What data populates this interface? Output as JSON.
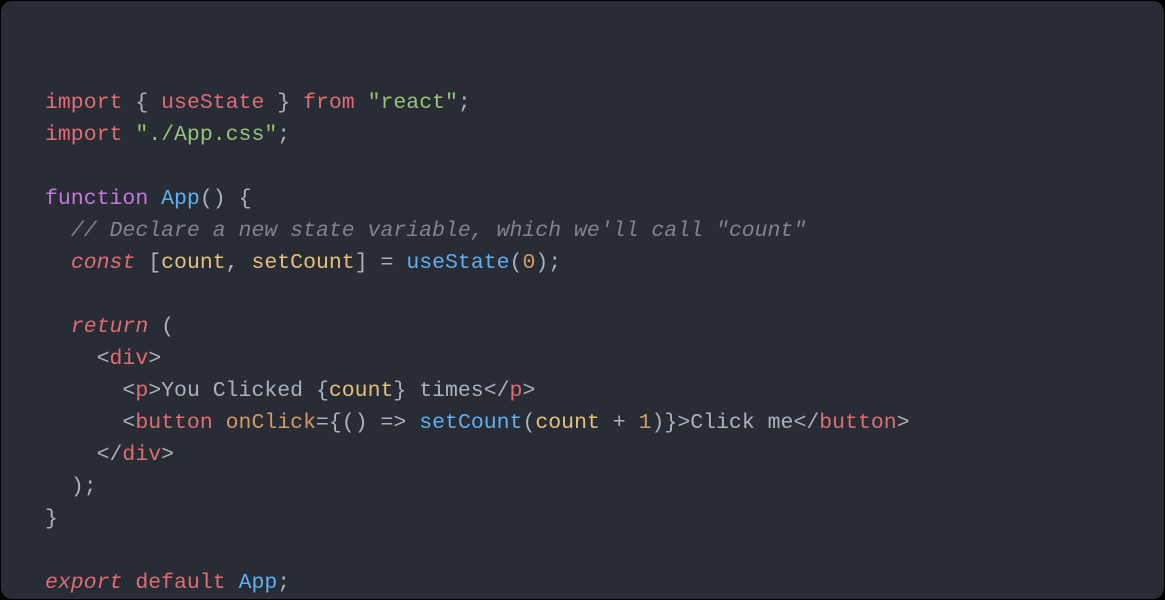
{
  "code": {
    "lines": [
      [
        {
          "t": "import",
          "c": "tok-keyword-red"
        },
        {
          "t": " ",
          "c": "tok-default"
        },
        {
          "t": "{",
          "c": "tok-punct"
        },
        {
          "t": " ",
          "c": "tok-default"
        },
        {
          "t": "useState",
          "c": "tok-ident2"
        },
        {
          "t": " ",
          "c": "tok-default"
        },
        {
          "t": "}",
          "c": "tok-punct"
        },
        {
          "t": " ",
          "c": "tok-default"
        },
        {
          "t": "from",
          "c": "tok-keyword-red"
        },
        {
          "t": " ",
          "c": "tok-default"
        },
        {
          "t": "\"react\"",
          "c": "tok-string"
        },
        {
          "t": ";",
          "c": "tok-punct"
        }
      ],
      [
        {
          "t": "import",
          "c": "tok-keyword-red"
        },
        {
          "t": " ",
          "c": "tok-default"
        },
        {
          "t": "\"./App.css\"",
          "c": "tok-string"
        },
        {
          "t": ";",
          "c": "tok-punct"
        }
      ],
      [],
      [
        {
          "t": "function",
          "c": "tok-keyword-purple"
        },
        {
          "t": " ",
          "c": "tok-default"
        },
        {
          "t": "App",
          "c": "tok-func"
        },
        {
          "t": "()",
          "c": "tok-punct"
        },
        {
          "t": " ",
          "c": "tok-default"
        },
        {
          "t": "{",
          "c": "tok-punct"
        }
      ],
      [
        {
          "t": "  ",
          "c": "tok-default"
        },
        {
          "t": "// Declare a new state variable, which we'll call \"count\"",
          "c": "tok-comment"
        }
      ],
      [
        {
          "t": "  ",
          "c": "tok-default"
        },
        {
          "t": "const",
          "c": "tok-keyword-italic"
        },
        {
          "t": " ",
          "c": "tok-default"
        },
        {
          "t": "[",
          "c": "tok-punct"
        },
        {
          "t": "count",
          "c": "tok-ident"
        },
        {
          "t": ",",
          "c": "tok-punct"
        },
        {
          "t": " ",
          "c": "tok-default"
        },
        {
          "t": "setCount",
          "c": "tok-ident"
        },
        {
          "t": "]",
          "c": "tok-punct"
        },
        {
          "t": " ",
          "c": "tok-default"
        },
        {
          "t": "=",
          "c": "tok-punct"
        },
        {
          "t": " ",
          "c": "tok-default"
        },
        {
          "t": "useState",
          "c": "tok-func"
        },
        {
          "t": "(",
          "c": "tok-punct"
        },
        {
          "t": "0",
          "c": "tok-number"
        },
        {
          "t": ")",
          "c": "tok-punct"
        },
        {
          "t": ";",
          "c": "tok-punct"
        }
      ],
      [],
      [
        {
          "t": "  ",
          "c": "tok-default"
        },
        {
          "t": "return",
          "c": "tok-keyword-italic"
        },
        {
          "t": " ",
          "c": "tok-default"
        },
        {
          "t": "(",
          "c": "tok-punct"
        }
      ],
      [
        {
          "t": "    ",
          "c": "tok-default"
        },
        {
          "t": "<",
          "c": "tok-punct"
        },
        {
          "t": "div",
          "c": "tok-ident2"
        },
        {
          "t": ">",
          "c": "tok-punct"
        }
      ],
      [
        {
          "t": "      ",
          "c": "tok-default"
        },
        {
          "t": "<",
          "c": "tok-punct"
        },
        {
          "t": "p",
          "c": "tok-ident2"
        },
        {
          "t": ">",
          "c": "tok-punct"
        },
        {
          "t": "You Clicked ",
          "c": "tok-text"
        },
        {
          "t": "{",
          "c": "tok-punct"
        },
        {
          "t": "count",
          "c": "tok-ident"
        },
        {
          "t": "}",
          "c": "tok-punct"
        },
        {
          "t": " times",
          "c": "tok-text"
        },
        {
          "t": "</",
          "c": "tok-punct"
        },
        {
          "t": "p",
          "c": "tok-ident2"
        },
        {
          "t": ">",
          "c": "tok-punct"
        }
      ],
      [
        {
          "t": "      ",
          "c": "tok-default"
        },
        {
          "t": "<",
          "c": "tok-punct"
        },
        {
          "t": "button",
          "c": "tok-ident2"
        },
        {
          "t": " ",
          "c": "tok-default"
        },
        {
          "t": "onClick",
          "c": "tok-attr"
        },
        {
          "t": "=",
          "c": "tok-punct"
        },
        {
          "t": "{",
          "c": "tok-punct"
        },
        {
          "t": "()",
          "c": "tok-punct"
        },
        {
          "t": " ",
          "c": "tok-default"
        },
        {
          "t": "=>",
          "c": "tok-punct"
        },
        {
          "t": " ",
          "c": "tok-default"
        },
        {
          "t": "setCount",
          "c": "tok-func"
        },
        {
          "t": "(",
          "c": "tok-punct"
        },
        {
          "t": "count",
          "c": "tok-ident"
        },
        {
          "t": " ",
          "c": "tok-default"
        },
        {
          "t": "+",
          "c": "tok-punct"
        },
        {
          "t": " ",
          "c": "tok-default"
        },
        {
          "t": "1",
          "c": "tok-number"
        },
        {
          "t": ")",
          "c": "tok-punct"
        },
        {
          "t": "}",
          "c": "tok-punct"
        },
        {
          "t": ">",
          "c": "tok-punct"
        },
        {
          "t": "Click me",
          "c": "tok-text"
        },
        {
          "t": "</",
          "c": "tok-punct"
        },
        {
          "t": "button",
          "c": "tok-ident2"
        },
        {
          "t": ">",
          "c": "tok-punct"
        }
      ],
      [
        {
          "t": "    ",
          "c": "tok-default"
        },
        {
          "t": "</",
          "c": "tok-punct"
        },
        {
          "t": "div",
          "c": "tok-ident2"
        },
        {
          "t": ">",
          "c": "tok-punct"
        }
      ],
      [
        {
          "t": "  ",
          "c": "tok-default"
        },
        {
          "t": ")",
          "c": "tok-punct"
        },
        {
          "t": ";",
          "c": "tok-punct"
        }
      ],
      [
        {
          "t": "}",
          "c": "tok-punct"
        }
      ],
      [],
      [
        {
          "t": "export",
          "c": "tok-keyword-italic"
        },
        {
          "t": " ",
          "c": "tok-default"
        },
        {
          "t": "default",
          "c": "tok-keyword-red"
        },
        {
          "t": " ",
          "c": "tok-default"
        },
        {
          "t": "App",
          "c": "tok-func"
        },
        {
          "t": ";",
          "c": "tok-punct"
        }
      ]
    ]
  }
}
